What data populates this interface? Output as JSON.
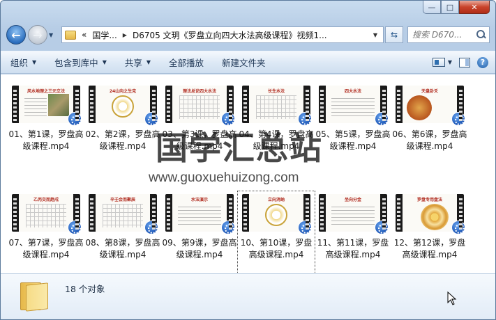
{
  "window": {
    "caption_buttons": {
      "minimize": "—",
      "maximize": "□",
      "close": "✕"
    }
  },
  "nav": {
    "back_glyph": "←",
    "forward_glyph": "→",
    "breadcrumb": [
      "国学...",
      "D6705 文玥《罗盘立向四大水法高级课程》视频1..."
    ],
    "crumb_prefix": "«",
    "search_placeholder": "搜索 D670..."
  },
  "toolbar": {
    "organize": "组织",
    "include_library": "包含到库中",
    "share": "共享",
    "play_all": "全部播放",
    "new_folder": "新建文件夹",
    "help": "?"
  },
  "files": [
    {
      "label": "01、第1课，罗盘高级课程.mp4",
      "thumb_title": "风水地理之三元立法"
    },
    {
      "label": "02、第2课，罗盘高级课程.mp4",
      "thumb_title": "24山向之生克"
    },
    {
      "label": "03、第3课，罗盘高级课程.mp4",
      "thumb_title": "理法总论四大水法"
    },
    {
      "label": "04、第4课，罗盘高级课程.mp4",
      "thumb_title": "长生水法"
    },
    {
      "label": "05、第5课，罗盘高级课程.mp4",
      "thumb_title": "四大水法"
    },
    {
      "label": "06、第6课，罗盘高级课程.mp4",
      "thumb_title": "天盘卦爻"
    },
    {
      "label": "07、第7课，罗盘高级课程.mp4",
      "thumb_title": "乙丙交而趋戌"
    },
    {
      "label": "08、第8课，罗盘高级课程.mp4",
      "thumb_title": "辛壬会而聚辰"
    },
    {
      "label": "09、第9课，罗盘高级课程.mp4",
      "thumb_title": "水法演示"
    },
    {
      "label": "10、第10课，罗盘高级课程.mp4",
      "thumb_title": "立向消纳"
    },
    {
      "label": "11、第11课，罗盘高级课程.mp4",
      "thumb_title": "坐向分金"
    },
    {
      "label": "12、第12课，罗盘高级课程.mp4",
      "thumb_title": "罗盘专用盘法"
    }
  ],
  "selected_index": 9,
  "watermark": {
    "title": "国学汇总站",
    "url": "www.guoxuehuizong.com"
  },
  "status": {
    "count": "18 个对象"
  }
}
